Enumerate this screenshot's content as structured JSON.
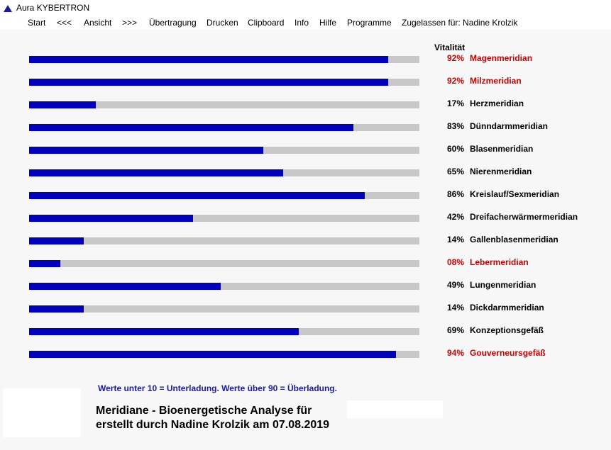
{
  "window": {
    "title": "Aura KYBERTRON",
    "icon": "triangle-icon"
  },
  "menu": [
    {
      "label": "Start"
    },
    {
      "label": "<<<"
    },
    {
      "label": "Ansicht"
    },
    {
      "label": ">>>"
    },
    {
      "label": "Übertragung"
    },
    {
      "label": "Drucken"
    },
    {
      "label": "Clipboard"
    },
    {
      "label": "Info"
    },
    {
      "label": "Hilfe"
    },
    {
      "label": "Programme"
    },
    {
      "label": "Zugelassen für: Nadine Krolzik"
    }
  ],
  "colors": {
    "bar_fill": "#0000c0",
    "bar_track": "#c8c8c8",
    "normal_text": "#000000",
    "alert_text": "#cc0000",
    "note_text": "#1a1aa8"
  },
  "column_header": "Vitalität",
  "chart_data": {
    "type": "bar",
    "orientation": "horizontal",
    "title": "Meridiane - Bioenergetische Analyse",
    "value_label": "Vitalität",
    "xlim": [
      0,
      100
    ],
    "categories": [
      "Magenmeridian",
      "Milzmeridian",
      "Herzmeridian",
      "Dünndarmmeridian",
      "Blasenmeridian",
      "Nierenmeridian",
      "Kreislauf/Sexmeridian",
      "Dreifacherwärmermeridian",
      "Gallenblasenmeridian",
      "Lebermeridian",
      "Lungenmeridian",
      "Dickdarmmeridian",
      "Konzeptionsgefäß",
      "Gouverneursgefäß"
    ],
    "values": [
      92,
      92,
      17,
      83,
      60,
      65,
      86,
      42,
      14,
      8,
      49,
      14,
      69,
      94
    ],
    "value_labels": [
      "92%",
      "92%",
      "17%",
      "83%",
      "60%",
      "65%",
      "86%",
      "42%",
      "14%",
      "08%",
      "49%",
      "14%",
      "69%",
      "94%"
    ],
    "alert": [
      true,
      true,
      false,
      false,
      false,
      false,
      false,
      false,
      false,
      true,
      false,
      false,
      false,
      true
    ]
  },
  "footer": {
    "note": "Werte unter 10 = Unterladung. Werte über 90 = Überladung.",
    "report_title": "Meridiane - Bioenergetische Analyse für",
    "report_sub": "erstellt durch Nadine Krolzik am 07.08.2019"
  }
}
